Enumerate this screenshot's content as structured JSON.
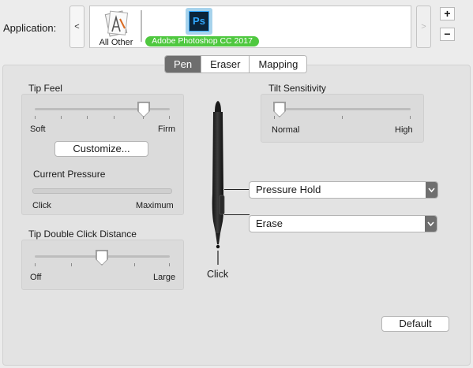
{
  "application": {
    "label": "Application:",
    "apps": [
      {
        "name": "All Other"
      },
      {
        "name": "Adobe Photoshop CC 2017",
        "icon_text": "Ps"
      }
    ],
    "prev_arrow": "<",
    "next_arrow": ">",
    "add": "+",
    "remove": "−"
  },
  "tabs": [
    {
      "label": "Pen",
      "active": true
    },
    {
      "label": "Eraser",
      "active": false
    },
    {
      "label": "Mapping",
      "active": false
    }
  ],
  "tip_feel": {
    "title": "Tip Feel",
    "min_label": "Soft",
    "max_label": "Firm",
    "value": 0.8,
    "customize_label": "Customize...",
    "current_pressure_title": "Current Pressure",
    "pressure_min_label": "Click",
    "pressure_max_label": "Maximum",
    "pressure_value": 0
  },
  "tilt": {
    "title": "Tilt Sensitivity",
    "min_label": "Normal",
    "max_label": "High",
    "value": 0.0
  },
  "double_click": {
    "title": "Tip Double Click Distance",
    "min_label": "Off",
    "max_label": "Large",
    "value": 0.5
  },
  "pen": {
    "upper_button": "Pressure Hold",
    "lower_button": "Erase",
    "tip_label": "Click"
  },
  "default_label": "Default",
  "colors": {
    "ps_badge": "#4fc83f",
    "active_tab": "#6e6e6e"
  }
}
